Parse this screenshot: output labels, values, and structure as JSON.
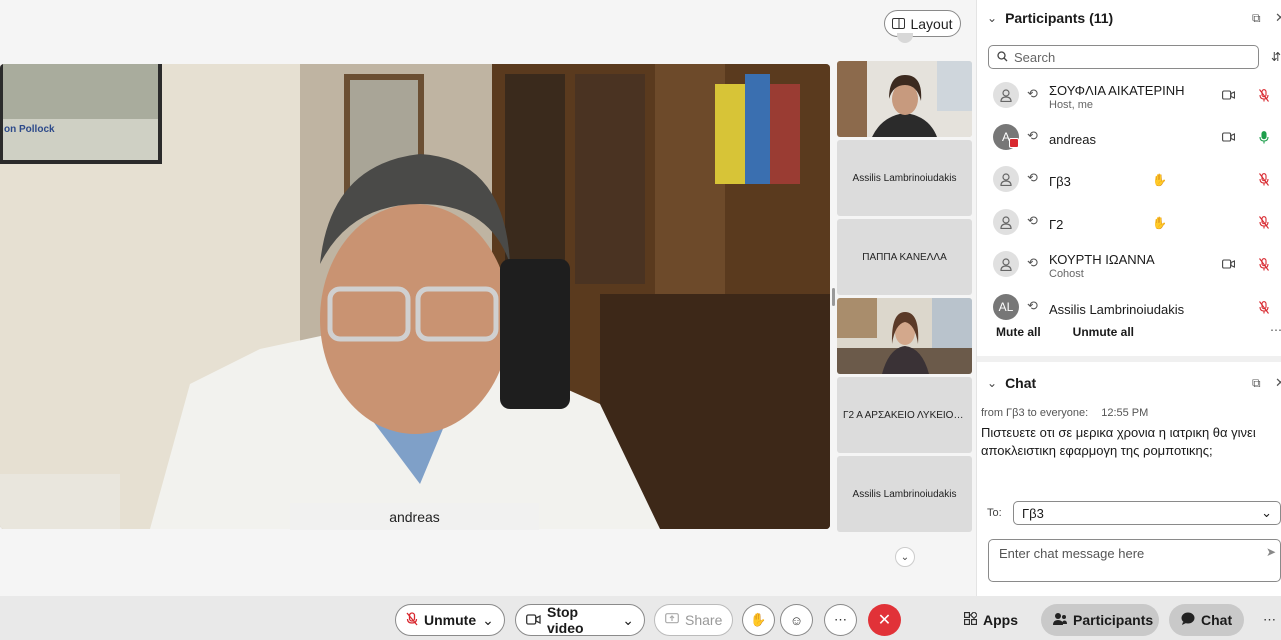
{
  "stage": {
    "layout_label": "Layout",
    "main_speaker": "andreas",
    "thumbnails": [
      {
        "type": "video",
        "label": ""
      },
      {
        "type": "name",
        "label": "Assilis Lambrinoiudakis"
      },
      {
        "type": "name",
        "label": "ΠΑΠΠΑ ΚΑΝΕΛΛΑ"
      },
      {
        "type": "video",
        "label": ""
      },
      {
        "type": "name",
        "label": "Γ2 Α ΑΡΣΑΚΕΙΟ ΛΥΚΕΙΟ Ψ..."
      },
      {
        "type": "name",
        "label": "Assilis Lambrinoiudakis"
      }
    ]
  },
  "participants": {
    "title": "Participants (11)",
    "search_placeholder": "Search",
    "list": [
      {
        "name": "ΣΟΥΦΛΙΑ ΑΙΚΑΤΕΡΙΝΗ",
        "subtitle": "Host, me",
        "avatar": "person-icon",
        "camera": true,
        "hand": false,
        "mic": "muted"
      },
      {
        "name": "andreas",
        "subtitle": "",
        "avatar": "A",
        "camera": true,
        "hand": false,
        "mic": "on"
      },
      {
        "name": "Γβ3",
        "subtitle": "",
        "avatar": "person-icon",
        "camera": false,
        "hand": true,
        "mic": "muted"
      },
      {
        "name": "Γ2",
        "subtitle": "",
        "avatar": "person-icon",
        "camera": false,
        "hand": true,
        "mic": "muted"
      },
      {
        "name": "ΚΟΥΡΤΗ ΙΩΑΝΝΑ",
        "subtitle": "Cohost",
        "avatar": "person-icon",
        "camera": true,
        "hand": false,
        "mic": "muted"
      },
      {
        "name": "Assilis Lambrinoiudakis",
        "subtitle": "",
        "avatar": "AL",
        "camera": false,
        "hand": false,
        "mic": "muted"
      }
    ],
    "mute_all": "Mute all",
    "unmute_all": "Unmute all"
  },
  "chat": {
    "title": "Chat",
    "meta": "from Γβ3 to everyone:",
    "time": "12:55 PM",
    "message_line1": "Πιστευετε οτι σε μερικα χρονια η ιατρικη θα γινει",
    "message_line2": "αποκλειστικη εφαρμογη της ρομποτικης;",
    "to_label": "To:",
    "to_value": "Γβ3",
    "input_placeholder": "Enter chat message here"
  },
  "toolbar": {
    "unmute": "Unmute",
    "stop_video": "Stop video",
    "share": "Share",
    "apps": "Apps",
    "participants": "Participants",
    "chat": "Chat"
  },
  "colors": {
    "end_call": "#e13238",
    "muted_mic": "#d8282f",
    "active_mic": "#1d9e4b"
  }
}
